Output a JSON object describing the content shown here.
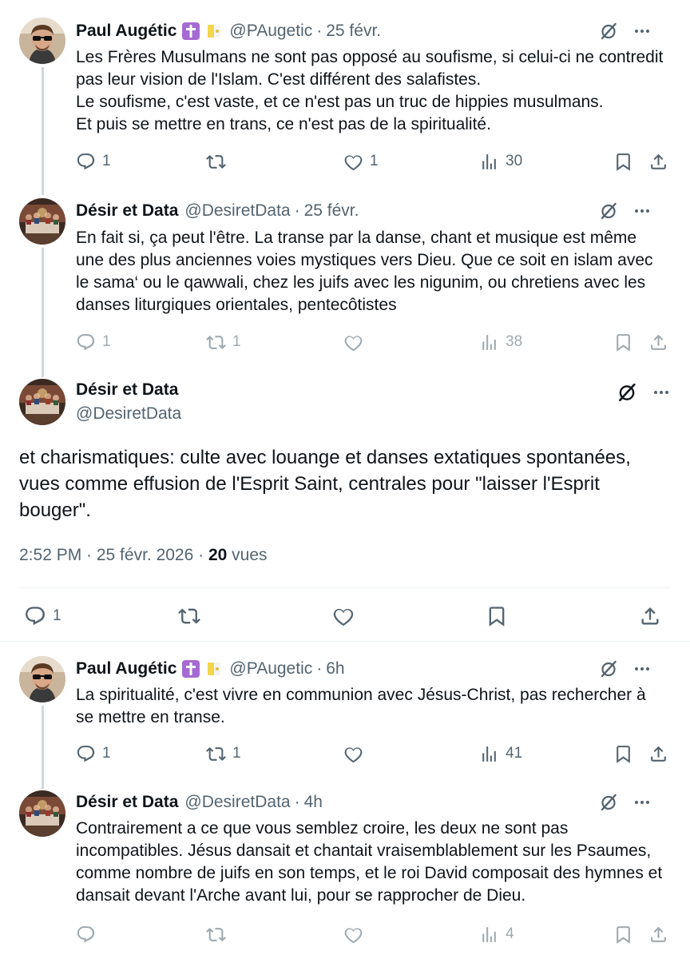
{
  "tweets": [
    {
      "name": "Paul Augétic",
      "handle": "@PAugetic",
      "dot": "·",
      "time": "25 févr.",
      "text": "Les Frères Musulmans ne sont pas opposé au soufisme, si celui-ci ne contredit pas leur vision de l'Islam. C'est différent des salafistes.\nLe soufisme, c'est vaste, et ce n'est pas un truc de hippies musulmans.\nEt puis se mettre en trans, ce n'est pas de la spiritualité.",
      "replies": "1",
      "retweets": "",
      "likes": "1",
      "views": "30"
    },
    {
      "name": "Désir et Data",
      "handle": "@DesiretData",
      "dot": "·",
      "time": "25 févr.",
      "text": "En fait si, ça peut l'être. La transe par la danse, chant et musique est même une des plus anciennes voies mystiques vers Dieu. Que ce soit en islam avec le sama‘ ou le qawwali, chez les juifs avec les nigunim, ou chretiens avec les danses liturgiques orientales, pentecôtistes",
      "replies": "1",
      "retweets": "1",
      "likes": "",
      "views": "38"
    }
  ],
  "main_tweet": {
    "name": "Désir et Data",
    "handle": "@DesiretData",
    "text": "et charismatiques: culte avec louange et danses extatiques spontanées, vues comme effusion de l'Esprit Saint, centrales pour \"laisser l'Esprit bouger\".",
    "timestamp": "2:52 PM · 25 févr. 2026 ·",
    "views_count": "20",
    "views_label": "vues",
    "replies": "1"
  },
  "replies_after": [
    {
      "name": "Paul Augétic",
      "handle": "@PAugetic",
      "dot": "·",
      "time": "6h",
      "text": "La spiritualité, c'est vivre en communion avec Jésus-Christ, pas rechercher à se mettre en transe.",
      "replies": "1",
      "retweets": "1",
      "likes": "",
      "views": "41"
    },
    {
      "name": "Désir et Data",
      "handle": "@DesiretData",
      "dot": "·",
      "time": "4h",
      "text": "Contrairement a ce que vous semblez croire, les deux ne sont pas incompatibles. Jésus dansait et chantait vraisemblablement sur les Psaumes, comme nombre de juifs en son temps, et le roi David composait des hymnes et dansait devant l'Arche avant lui, pour se rapprocher de Dieu.",
      "replies": "",
      "retweets": "",
      "likes": "",
      "views": "4"
    }
  ],
  "colors": {
    "text": "#0f1419",
    "secondary": "#536471",
    "line": "#cfd9de",
    "badge_cross": "#a56bd4",
    "badge_flag": "#f3d64c"
  },
  "icons": [
    "reply-icon",
    "retweet-icon",
    "like-icon",
    "views-icon",
    "bookmark-icon",
    "share-icon",
    "grok-icon",
    "more-icon",
    "cross-badge-icon",
    "vatican-flag-icon"
  ]
}
